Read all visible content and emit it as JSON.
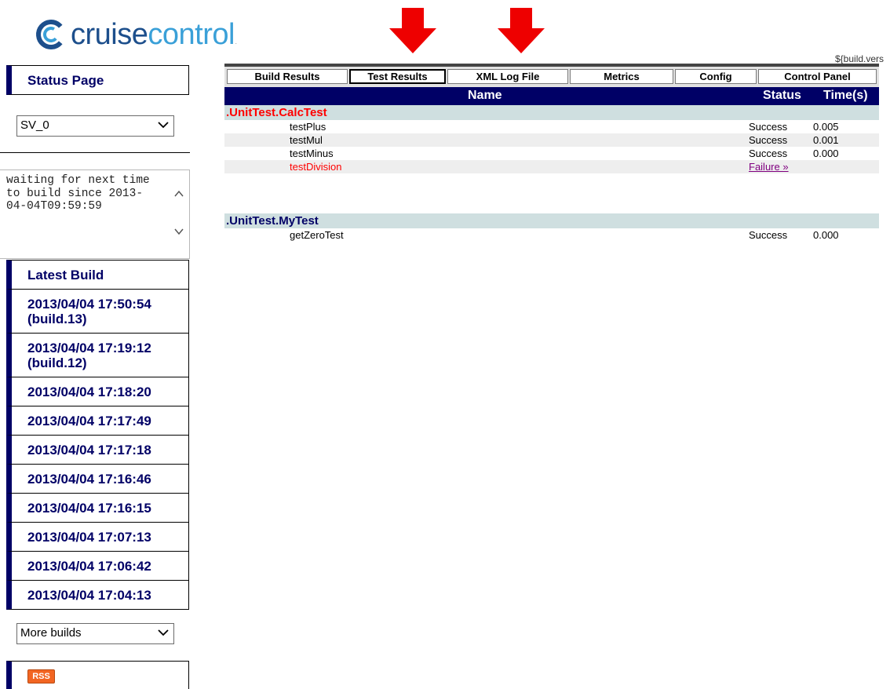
{
  "logo": {
    "text_part1": "cruise",
    "text_part2": "control",
    "tm": "."
  },
  "version_text": "${build.vers",
  "sidebar": {
    "status_page_label": "Status Page",
    "project_select_value": "SV_0",
    "status_text": "waiting for next time to build since 2013-04-04T09:59:59",
    "latest_build_label": "Latest Build",
    "builds": [
      "2013/04/04 17:50:54 (build.13)",
      "2013/04/04 17:19:12 (build.12)",
      "2013/04/04 17:18:20",
      "2013/04/04 17:17:49",
      "2013/04/04 17:17:18",
      "2013/04/04 17:16:46",
      "2013/04/04 17:16:15",
      "2013/04/04 17:07:13",
      "2013/04/04 17:06:42",
      "2013/04/04 17:04:13"
    ],
    "more_builds_value": "More builds",
    "rss_label": "RSS"
  },
  "tabs": [
    "Build Results",
    "Test Results",
    "XML Log File",
    "Metrics",
    "Config",
    "Control Panel"
  ],
  "active_tab": "Test Results",
  "table": {
    "headers": {
      "name": "Name",
      "status": "Status",
      "time": "Time(s)"
    },
    "suites": [
      {
        "name": ".UnitTest.CalcTest",
        "tests": [
          {
            "name": "testPlus",
            "status": "Success",
            "time": "0.005"
          },
          {
            "name": "testMul",
            "status": "Success",
            "time": "0.001"
          },
          {
            "name": "testMinus",
            "status": "Success",
            "time": "0.000"
          },
          {
            "name": "testDivision",
            "status": "Failure »",
            "time": ""
          }
        ]
      },
      {
        "name": ".UnitTest.MyTest",
        "tests": [
          {
            "name": "getZeroTest",
            "status": "Success",
            "time": "0.000"
          }
        ]
      }
    ]
  },
  "colors": {
    "sidebar_accent": "#000066",
    "failure": "#ff0000",
    "arrow": "#ee0000",
    "suite_bg": "#cfdfe0"
  }
}
